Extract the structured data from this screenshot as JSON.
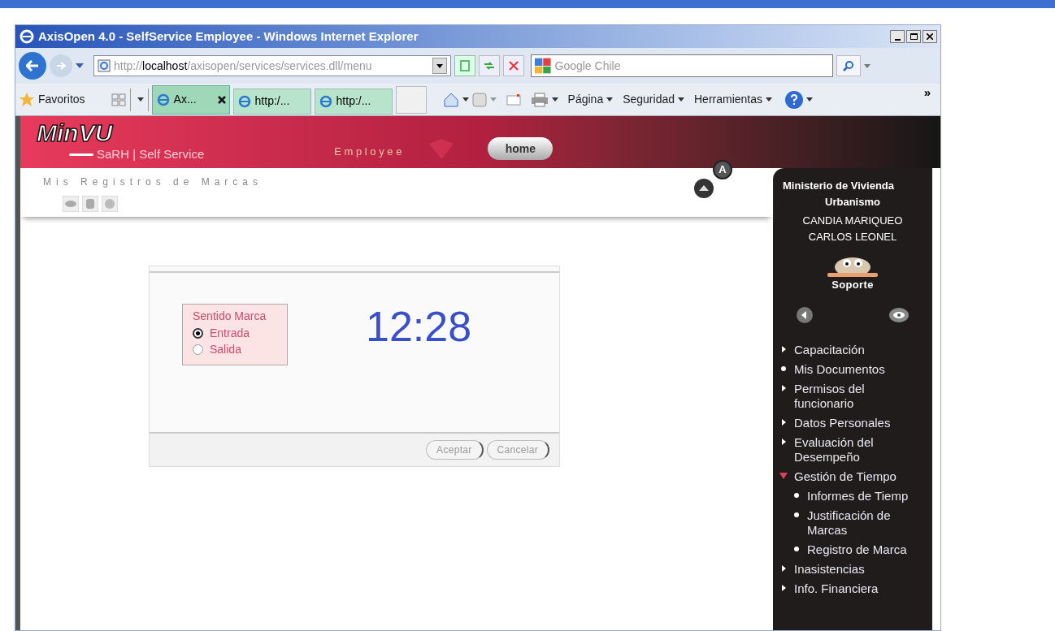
{
  "window": {
    "title": "AxisOpen 4.0 - SelfService Employee - Windows Internet Explorer"
  },
  "address_bar": {
    "host_prefix": "http://",
    "host": "localhost",
    "path": "/axisopen/services/services.dll/menu"
  },
  "search": {
    "placeholder": "Google Chile"
  },
  "favorites_label": "Favoritos",
  "tabs": [
    {
      "label": "Ax...",
      "selected": true
    },
    {
      "label": "http:/...",
      "selected": false
    },
    {
      "label": "http:/...",
      "selected": false
    }
  ],
  "command_bar": [
    "Página",
    "Seguridad",
    "Herramientas"
  ],
  "overflow": "»",
  "header": {
    "logo": "MinVU",
    "subtitle": "SaRH | Self Service",
    "employee": "E m p l o y e e",
    "home": "home",
    "font_button": "A",
    "page_title": "Mis Registros de Marcas"
  },
  "form": {
    "legend": "Sentido Marca",
    "options": [
      {
        "label": "Entrada",
        "selected": true
      },
      {
        "label": "Salida",
        "selected": false
      }
    ],
    "time": "12:28",
    "buttons": [
      "Aceptar",
      "Cancelar"
    ]
  },
  "sidebar": {
    "organization": "Ministerio de Vivienda",
    "organization_line2": "Urbanismo",
    "user_line1": "CANDIA MARIQUEO",
    "user_line2": "CARLOS LEONEL",
    "support": "Soporte",
    "items": [
      {
        "label": "Capacitación",
        "expanded": false
      },
      {
        "label": "Mis Documentos"
      },
      {
        "label": "Permisos del funcionario",
        "expanded": false
      },
      {
        "label": "Datos Personales",
        "expanded": false
      },
      {
        "label": "Evaluación del Desempeño",
        "expanded": false
      },
      {
        "label": "Gestión de Tiempo",
        "expanded": true,
        "children": [
          {
            "label": "Informes de Tiemp"
          },
          {
            "label": "Justificación de Marcas"
          },
          {
            "label": "Registro de Marca"
          }
        ]
      },
      {
        "label": "Inasistencias",
        "expanded": false
      },
      {
        "label": "Info. Financiera",
        "expanded": false
      }
    ]
  }
}
